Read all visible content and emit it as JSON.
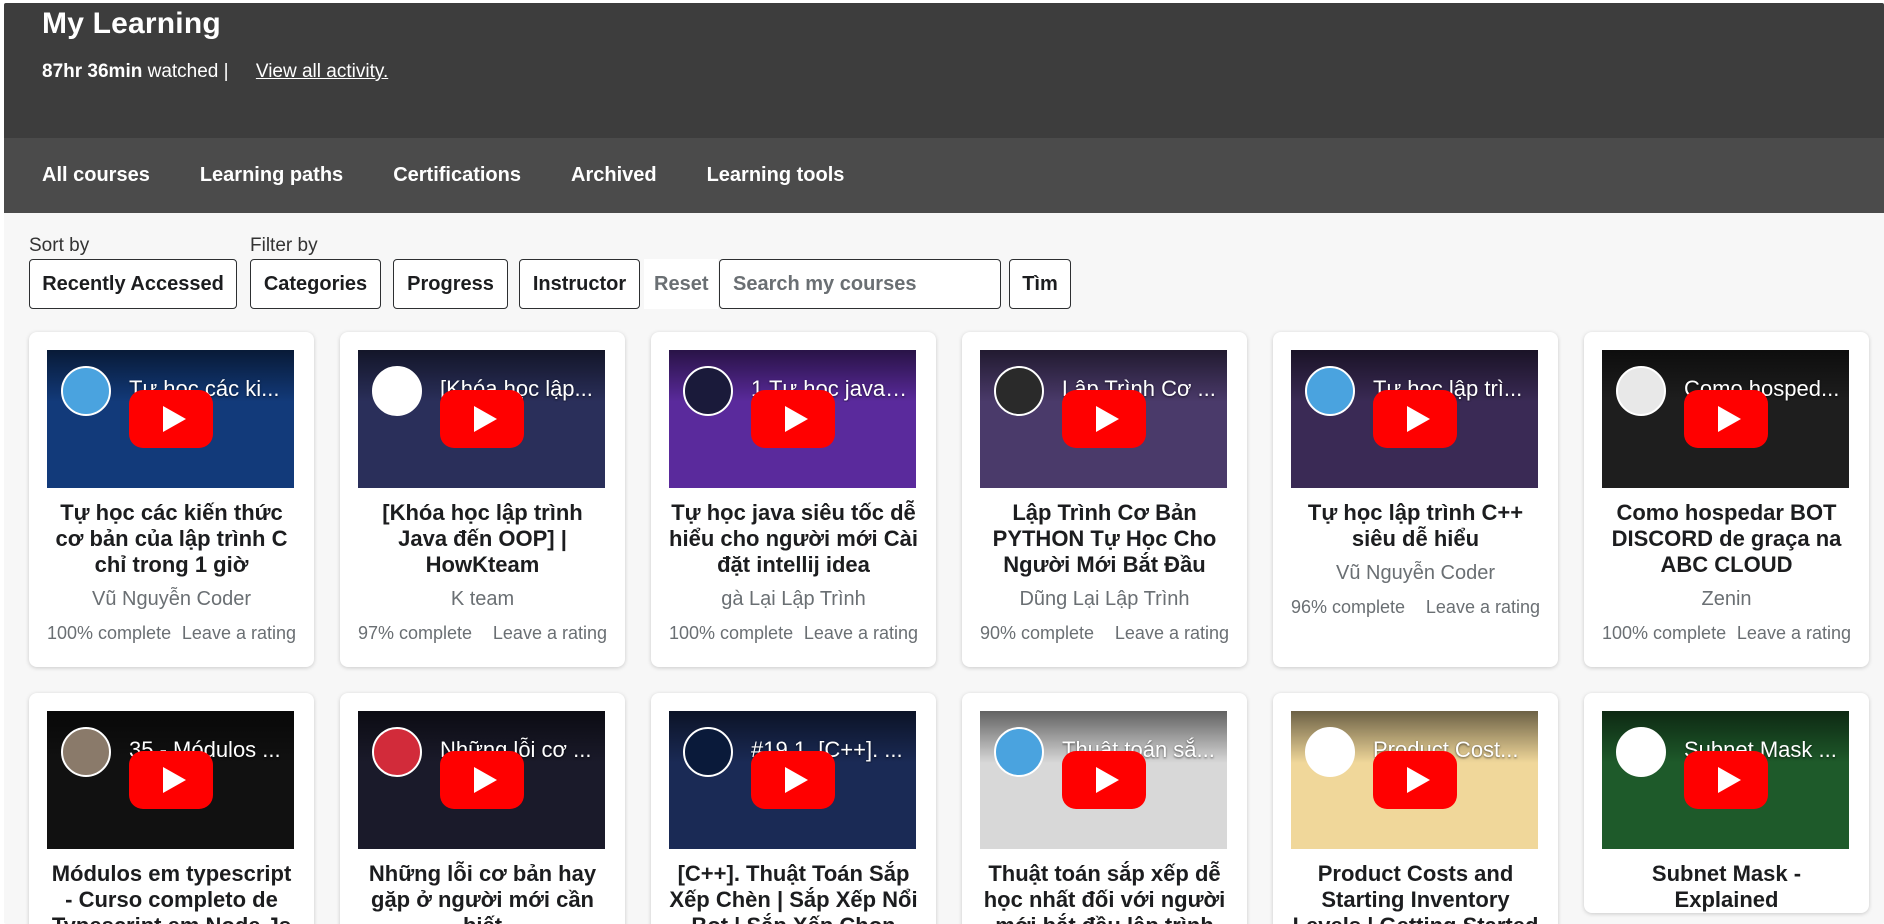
{
  "header": {
    "title": "My Learning",
    "watched_time": "87hr 36min",
    "watched_label": "watched |",
    "activity_link": "View all activity."
  },
  "tabs": [
    "All courses",
    "Learning paths",
    "Certifications",
    "Archived",
    "Learning tools"
  ],
  "toolbar": {
    "sort_label": "Sort by",
    "filter_label": "Filter by",
    "sort_value": "Recently Accessed",
    "filter_categories": "Categories",
    "filter_progress": "Progress",
    "filter_instructor": "Instructor",
    "reset": "Reset",
    "search_placeholder": "Search my courses",
    "search_button": "Tìm"
  },
  "colors": {
    "header_bg": "#3d3d3d",
    "tabs_bg": "#4b4b4b",
    "play_red": "#ff0000"
  },
  "courses": [
    {
      "thumb_title": "Tự học các ki...",
      "title": "Tự học các kiến thức cơ bản của lập trình C chỉ trong 1 giờ",
      "instructor": "Vũ Nguyễn Coder",
      "progress": "100% complete",
      "rating": "Leave a rating",
      "thumb_bg": "#123a7a",
      "avatar_bg": "#4aa3df"
    },
    {
      "thumb_title": "[Khóa học lập...",
      "title": "[Khóa học lập trình Java đến OOP] | HowKteam",
      "instructor": "K team",
      "progress": "97% complete",
      "rating": "Leave a rating",
      "thumb_bg": "#2a2f5a",
      "avatar_bg": "#ffffff"
    },
    {
      "thumb_title": "1 Tự học java ...",
      "title": "Tự học java siêu tốc dễ hiểu cho người mới Cài đặt intellij idea",
      "instructor": "gà Lại Lập Trình",
      "progress": "100% complete",
      "rating": "Leave a rating",
      "thumb_bg": "#5a2a9c",
      "avatar_bg": "#1a1a3a"
    },
    {
      "thumb_title": "Lập Trình Cơ ...",
      "title": "Lập Trình Cơ Bản PYTHON Tự Học Cho Người Mới Bắt Đầu",
      "instructor": "Dũng Lại Lập Trình",
      "progress": "90% complete",
      "rating": "Leave a rating",
      "thumb_bg": "#4a3a6a",
      "avatar_bg": "#2a2a2a"
    },
    {
      "thumb_title": "Tự học lập trì...",
      "title": "Tự học lập trình C++ siêu dễ hiểu",
      "instructor": "Vũ Nguyễn Coder",
      "progress": "96% complete",
      "rating": "Leave a rating",
      "thumb_bg": "#3a2a55",
      "avatar_bg": "#4aa3df"
    },
    {
      "thumb_title": "Como hosped...",
      "title": "Como hospedar BOT DISCORD de graça na ABC CLOUD",
      "instructor": "Zenin",
      "progress": "100% complete",
      "rating": "Leave a rating",
      "thumb_bg": "#1e1e1e",
      "avatar_bg": "#e8e8e8"
    },
    {
      "thumb_title": "35 - Módulos ...",
      "title": "Módulos em typescript - Curso completo de Typescript em Node.Js",
      "instructor": "",
      "progress": "",
      "rating": "",
      "thumb_bg": "#111111",
      "avatar_bg": "#8a7a6a"
    },
    {
      "thumb_title": "Những lỗi cơ ...",
      "title": "Những lỗi cơ bản hay gặp ở người mới cần biết",
      "instructor": "",
      "progress": "",
      "rating": "",
      "thumb_bg": "#1a1a2a",
      "avatar_bg": "#d22b3a"
    },
    {
      "thumb_title": "#19.1. [C++]. ...",
      "title": "[C++]. Thuật Toán Sắp Xếp Chèn | Sắp Xếp Nổi Bọt | Sắp Xếp Chọn",
      "instructor": "",
      "progress": "",
      "rating": "",
      "thumb_bg": "#1a2a55",
      "avatar_bg": "#0a1a3a"
    },
    {
      "thumb_title": "Thuật toán sắ...",
      "title": "Thuật toán sắp xếp dễ học nhất đối với người mới bắt đầu lập trình",
      "instructor": "",
      "progress": "",
      "rating": "",
      "thumb_bg": "#d8d8d8",
      "avatar_bg": "#4aa3df"
    },
    {
      "thumb_title": "Product Cost...",
      "title": "Product Costs and Starting Inventory Levels | Getting Started",
      "instructor": "",
      "progress": "",
      "rating": "",
      "thumb_bg": "#f0d79a",
      "avatar_bg": "#ffffff"
    },
    {
      "thumb_title": "Subnet Mask ...",
      "title": "Subnet Mask - Explained",
      "instructor": "",
      "progress": "",
      "rating": "",
      "thumb_bg": "#1e5a2a",
      "avatar_bg": "#ffffff"
    }
  ]
}
